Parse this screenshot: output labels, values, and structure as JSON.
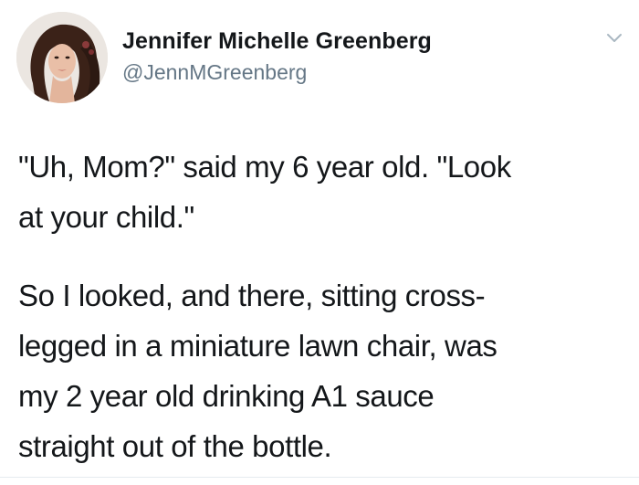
{
  "tweet": {
    "author": {
      "display_name": "Jennifer Michelle Greenberg",
      "handle": "@JennMGreenberg"
    },
    "menu_icon": "chevron-down-icon",
    "avatar_icon": "profile-photo",
    "paragraphs": [
      {
        "lines": [
          "\"Uh, Mom?\" said my 6 year old. \"Look",
          "at your child.\""
        ]
      },
      {
        "lines": [
          "So I looked, and there, sitting cross-",
          "legged in a miniature lawn chair, was",
          "my 2 year old drinking A1 sauce",
          "straight out of the bottle."
        ]
      }
    ]
  },
  "colors": {
    "text": "#14171a",
    "secondary_text": "#657786",
    "chevron": "#aab8c2",
    "background": "#ffffff"
  }
}
